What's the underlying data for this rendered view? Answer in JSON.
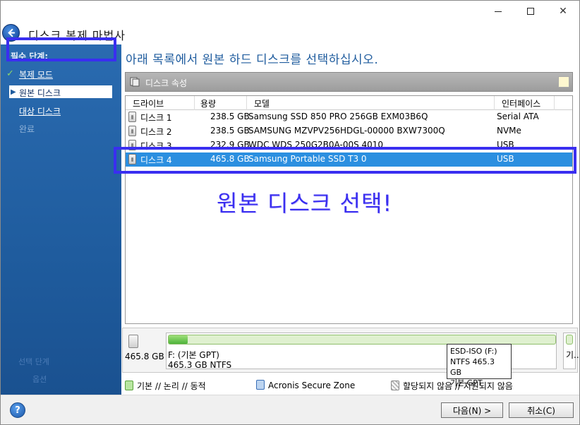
{
  "window": {
    "title": "디스크 복제 마법사"
  },
  "sidebar": {
    "heading": "필수 단계:",
    "items": [
      {
        "label": "복제 모드",
        "state": "done"
      },
      {
        "label": "원본 디스크",
        "state": "current"
      },
      {
        "label": "대상 디스크",
        "state": "pending"
      },
      {
        "label": "완료",
        "state": "disabled"
      }
    ],
    "faint_text_1": "선택 단계",
    "faint_text_2": "옵션"
  },
  "main": {
    "instruction": "아래 목록에서 원본 하드 디스크를 선택하십시오.",
    "panel_title": "디스크 속성",
    "columns": [
      "드라이브",
      "용량",
      "모델",
      "인터페이스"
    ],
    "rows": [
      {
        "drive": "디스크 1",
        "capacity": "238.5 GB",
        "model": "Samsung SSD 850 PRO 256GB EXM03B6Q",
        "interface": "Serial ATA",
        "selected": false
      },
      {
        "drive": "디스크 2",
        "capacity": "238.5 GB",
        "model": "SAMSUNG MZVPV256HDGL-00000 BXW7300Q",
        "interface": "NVMe",
        "selected": false
      },
      {
        "drive": "디스크 3",
        "capacity": "232.9 GB",
        "model": "WDC WDS 250G2B0A-00S 4010",
        "interface": "USB",
        "selected": false
      },
      {
        "drive": "디스크 4",
        "capacity": "465.8 GB",
        "model": "Samsung Portable SSD T3 0",
        "interface": "USB",
        "selected": true
      }
    ],
    "annotation": "원본 디스크 선택!"
  },
  "diskmap": {
    "disk_size": "465.8 GB",
    "partition_label": "F: (기본 GPT)",
    "partition_detail": "465.3 GB  NTFS",
    "used_fraction": 0.05,
    "extra_label": "기...",
    "tooltip_line1": "ESD-ISO (F:)",
    "tooltip_line2": "NTFS 465.3 GB",
    "tooltip_line3": "기본 GPT"
  },
  "legend": {
    "primary": "기본 // 논리 // 동적",
    "secure_zone": "Acronis Secure Zone",
    "unallocated": "할당되지 않음 // 지원되지 않음"
  },
  "footer": {
    "help": "?",
    "next_label": "다음(N) >",
    "cancel_label": "취소(C)"
  },
  "colors": {
    "sidebar": "#1f5c9e",
    "selection": "#2b8fe0",
    "annotation": "#3a2ef0"
  }
}
